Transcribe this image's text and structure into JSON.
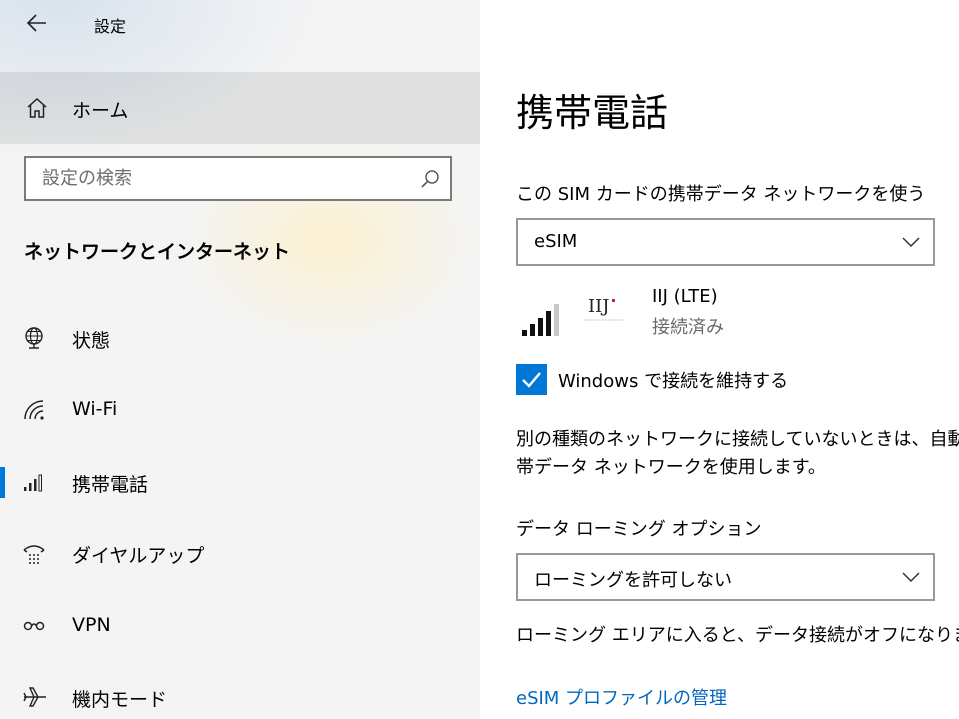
{
  "window": {
    "title": "設定"
  },
  "sidebar": {
    "home_label": "ホーム",
    "search": {
      "placeholder": "設定の検索"
    },
    "section_heading": "ネットワークとインターネット",
    "items": [
      {
        "label": "状態",
        "icon": "globe-icon",
        "selected": false
      },
      {
        "label": "Wi-Fi",
        "icon": "wifi-icon",
        "selected": false
      },
      {
        "label": "携帯電話",
        "icon": "cellular-icon",
        "selected": true
      },
      {
        "label": "ダイヤルアップ",
        "icon": "dialup-icon",
        "selected": false
      },
      {
        "label": "VPN",
        "icon": "vpn-icon",
        "selected": false
      },
      {
        "label": "機内モード",
        "icon": "airplane-icon",
        "selected": false
      }
    ]
  },
  "main": {
    "title": "携帯電話",
    "sim_network_label": "この SIM カードの携帯データ ネットワークを使う",
    "sim_dropdown_value": "eSIM",
    "carrier": {
      "logo_text": "IIJ",
      "name": "IIJ (LTE)",
      "status": "接続済み"
    },
    "keep_connected": {
      "label": "Windows で接続を維持する",
      "checked": true
    },
    "description_line1": "別の種類のネットワークに接続していないときは、自動的",
    "description_line2": "帯データ ネットワークを使用します。",
    "roaming_label": "データ ローミング オプション",
    "roaming_dropdown_value": "ローミングを許可しない",
    "roaming_note": "ローミング エリアに入ると、データ接続がオフになります。",
    "esim_link": "eSIM プロファイルの管理"
  },
  "colors": {
    "accent": "#0078d7",
    "link": "#0067c0",
    "sidebar_bg": "#f4f4f4",
    "logo_accent": "#c2185b"
  }
}
